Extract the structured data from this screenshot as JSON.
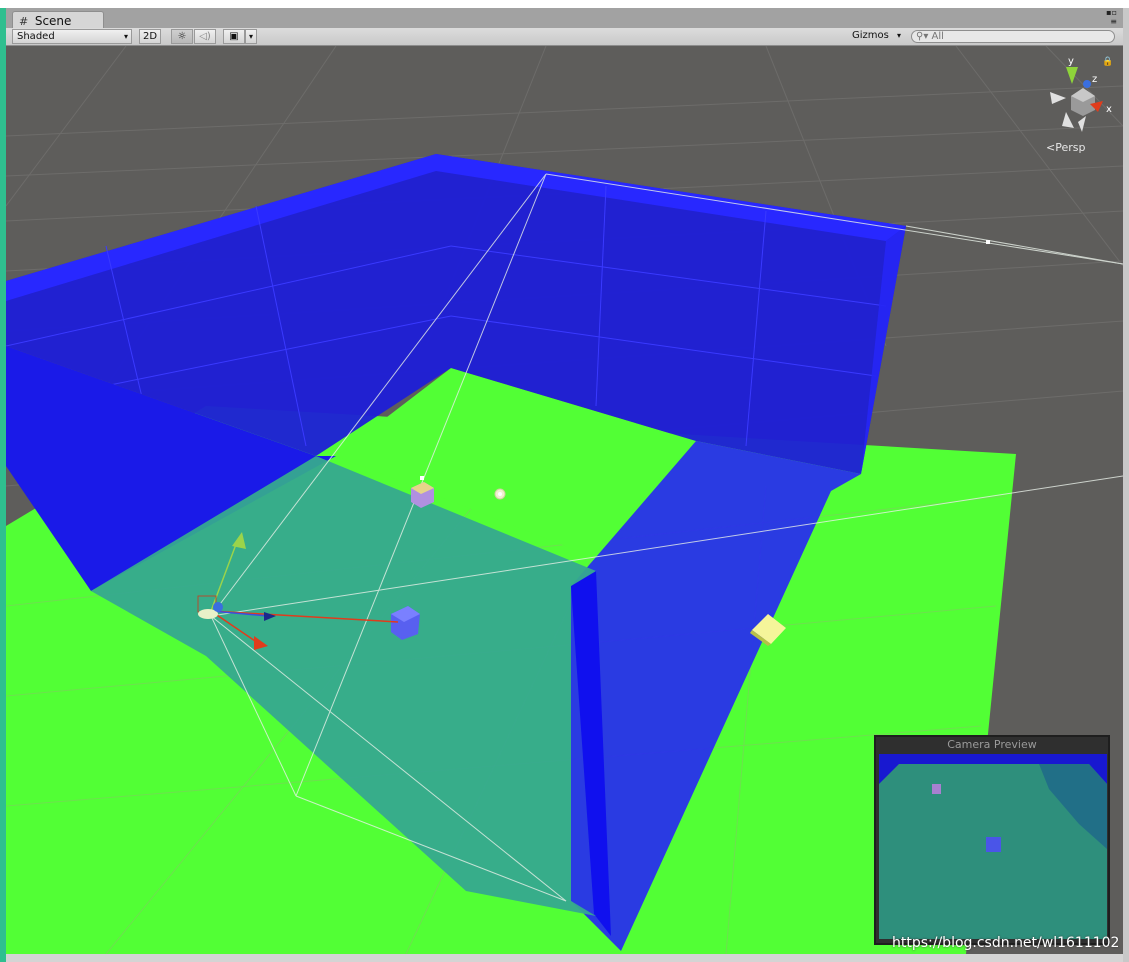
{
  "window": {
    "tab_label": "Scene",
    "tab_icon": "grid-icon"
  },
  "toolbar": {
    "shading_mode": "Shaded",
    "mode_2d_label": "2D",
    "lighting_icon": "sun-icon",
    "audio_icon": "speaker-icon",
    "effects_icon": "image-icon",
    "gizmos_label": "Gizmos",
    "search_placeholder": "All",
    "search_icon": "search-icon"
  },
  "viewport": {
    "projection_label": "Persp",
    "axis_labels": {
      "x": "x",
      "y": "y",
      "z": "z"
    },
    "colors": {
      "background": "#5e5d5b",
      "floor": "#52ff35",
      "wall": "#1a1aff",
      "translucent_wall": "#3f8fbf",
      "axis_x": "#e03c1c",
      "axis_y": "#8ed43a",
      "axis_z": "#3a6fe0"
    }
  },
  "camera_preview": {
    "title": "Camera Preview"
  },
  "watermark": "https://blog.csdn.net/wl1611102"
}
